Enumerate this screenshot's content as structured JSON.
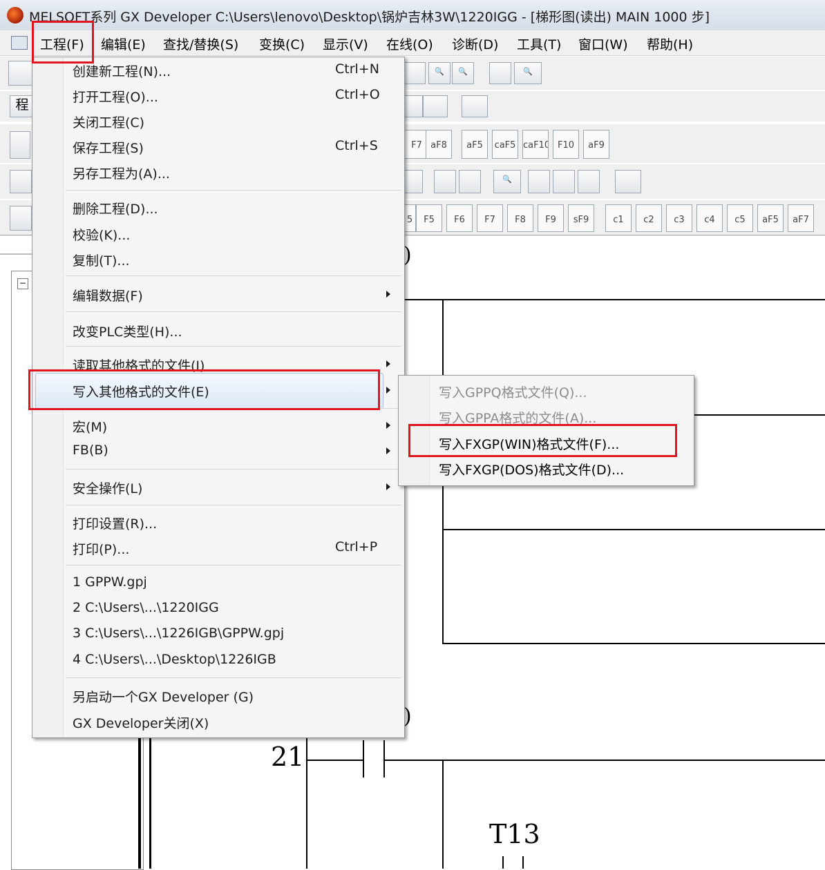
{
  "window": {
    "title": "MELSOFT系列 GX Developer C:\\Users\\lenovo\\Desktop\\锅炉吉林3W\\1220IGG - [梯形图(读出)   MAIN   1000 步]"
  },
  "menubar": [
    "工程(F)",
    "编辑(E)",
    "查找/替换(S)",
    "变换(C)",
    "显示(V)",
    "在线(O)",
    "诊断(D)",
    "工具(T)",
    "窗口(W)",
    "帮助(H)"
  ],
  "menu": {
    "items": [
      {
        "label": "创建新工程(N)...",
        "shortcut": "Ctrl+N"
      },
      {
        "label": "打开工程(O)...",
        "shortcut": "Ctrl+O"
      },
      {
        "label": "关闭工程(C)"
      },
      {
        "label": "保存工程(S)",
        "shortcut": "Ctrl+S"
      },
      {
        "label": "另存工程为(A)..."
      },
      {
        "label": "删除工程(D)..."
      },
      {
        "label": "校验(K)..."
      },
      {
        "label": "复制(T)..."
      },
      {
        "label": "编辑数据(F)",
        "submenu": true
      },
      {
        "label": "改变PLC类型(H)..."
      },
      {
        "label": "读取其他格式的文件(I)",
        "submenu": true
      },
      {
        "label": "写入其他格式的文件(E)",
        "submenu": true,
        "highlighted": true
      },
      {
        "label": "宏(M)",
        "submenu": true
      },
      {
        "label": "FB(B)",
        "submenu": true
      },
      {
        "label": "安全操作(L)",
        "submenu": true
      },
      {
        "label": "打印设置(R)..."
      },
      {
        "label": "打印(P)...",
        "shortcut": "Ctrl+P"
      },
      {
        "label": "1 GPPW.gpj"
      },
      {
        "label": "2 C:\\Users\\...\\1220IGG"
      },
      {
        "label": "3 C:\\Users\\...\\1226IGB\\GPPW.gpj"
      },
      {
        "label": "4 C:\\Users\\...\\Desktop\\1226IGB"
      },
      {
        "label": "另启动一个GX Developer (G)"
      },
      {
        "label": "GX Developer关闭(X)"
      }
    ]
  },
  "submenu": {
    "items": [
      {
        "label": "写入GPPQ格式文件(Q)...",
        "enabled": false
      },
      {
        "label": "写入GPPA格式的文件(A)...",
        "enabled": false
      },
      {
        "label": "写入FXGP(WIN)格式文件(F)...",
        "enabled": true
      },
      {
        "label": "写入FXGP(DOS)格式文件(D)...",
        "enabled": true
      }
    ]
  },
  "toolbar": {
    "fkeys_row3": [
      "F7",
      "aF8",
      "aF5",
      "caF5",
      "caF10",
      "F10",
      "aF9"
    ],
    "fkeys_row5": [
      "5",
      "F5",
      "F6",
      "F7",
      "F8",
      "F9",
      "sF9",
      "c1",
      "c2",
      "c3",
      "c4",
      "c5",
      "aF5",
      "aF7"
    ],
    "left_label": "程"
  },
  "ladder": {
    "step_number": "21",
    "contact_label": "T13",
    "paren_top": ")",
    "paren_bottom": ")"
  },
  "colors": {
    "annotation": "#e0141c",
    "highlight": "#dde9f7"
  }
}
